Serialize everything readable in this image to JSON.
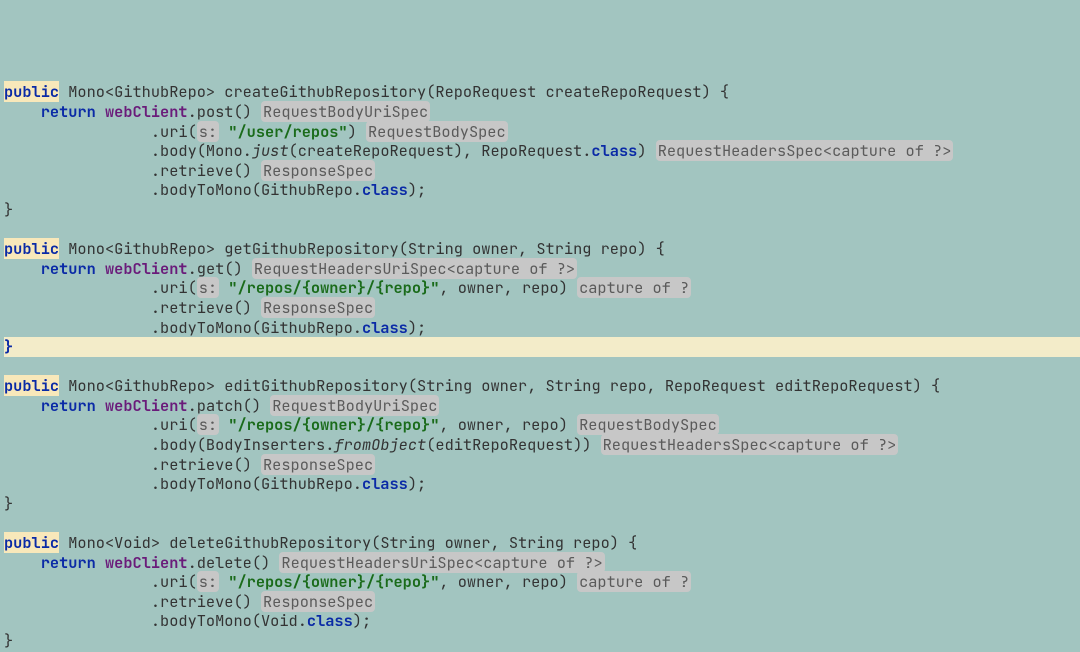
{
  "hints": {
    "reqBodyUriSpec": "RequestBodyUriSpec",
    "reqBodySpec": "RequestBodySpec",
    "reqHeadersSpecCap": "RequestHeadersSpec<capture of ?>",
    "reqHeadersUriSpecCap": "RequestHeadersUriSpec<capture of ?>",
    "captureOf": "capture of ?",
    "responseSpec": "ResponseSpec",
    "sLabel": "s:"
  },
  "kw": {
    "public": "public",
    "return": "return",
    "class": "class"
  },
  "m1": {
    "returnType": " Mono<GithubRepo> ",
    "name": "createGithubRepository",
    "params": "(RepoRequest createRepoRequest) {",
    "l2a": " webClient",
    "l2b": ".post()",
    "l3a": "                .uri(",
    "l3str": " \"/user/repos\"",
    "l3b": ")",
    "l4a": "                .body(Mono.",
    "l4just": "just",
    "l4b": "(createRepoRequest), RepoRequest.",
    "l4c": ")",
    "l5": "                .retrieve()",
    "l6a": "                .bodyToMono(GithubRepo.",
    "l6b": ");"
  },
  "m2": {
    "returnType": " Mono<GithubRepo> ",
    "name": "getGithubRepository",
    "params": "(String owner, String repo) {",
    "l2a": " webClient",
    "l2b": ".get()",
    "l3a": "                .uri(",
    "l3str": " \"/repos/{owner}/{repo}\"",
    "l3b": ", owner, repo)",
    "l4": "                .retrieve()",
    "l5a": "                .bodyToMono(GithubRepo.",
    "l5b": ");"
  },
  "m3": {
    "returnType": " Mono<GithubRepo> ",
    "name": "editGithubRepository",
    "params": "(String owner, String repo, RepoRequest editRepoRequest) {",
    "l2a": " webClient",
    "l2b": ".patch()",
    "l3a": "                .uri(",
    "l3str": " \"/repos/{owner}/{repo}\"",
    "l3b": ", owner, repo)",
    "l4a": "                .body(BodyInserters.",
    "l4from": "fromObject",
    "l4b": "(editRepoRequest))",
    "l5": "                .retrieve()",
    "l6a": "                .bodyToMono(GithubRepo.",
    "l6b": ");"
  },
  "m4": {
    "returnType": " Mono<Void> ",
    "name": "deleteGithubRepository",
    "params": "(String owner, String repo) {",
    "l2a": " webClient",
    "l2b": ".delete()",
    "l3a": "                .uri(",
    "l3str": " \"/repos/{owner}/{repo}\"",
    "l3b": ", owner, repo)",
    "l4": "                .retrieve()",
    "l5a": "                .bodyToMono(Void.",
    "l5b": ");"
  },
  "brace": {
    "close": "}"
  },
  "indent": {
    "ret": "    "
  }
}
